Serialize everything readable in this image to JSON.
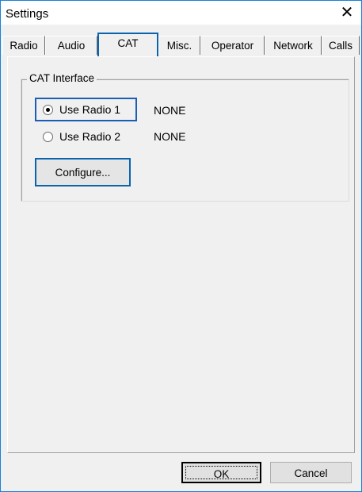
{
  "window": {
    "title": "Settings",
    "close_glyph": "✕"
  },
  "tabs": [
    {
      "label": "Radio"
    },
    {
      "label": "Audio"
    },
    {
      "label": "CAT"
    },
    {
      "label": "Misc."
    },
    {
      "label": "Operator"
    },
    {
      "label": "Network"
    },
    {
      "label": "Calls"
    }
  ],
  "active_tab": "CAT",
  "cat_interface": {
    "group_label": "CAT Interface",
    "radio1": {
      "label": "Use Radio 1",
      "value": "NONE",
      "checked": true
    },
    "radio2": {
      "label": "Use Radio 2",
      "value": "NONE",
      "checked": false
    },
    "configure_label": "Configure..."
  },
  "footer": {
    "ok_label": "OK",
    "cancel_label": "Cancel"
  },
  "colors": {
    "accent": "#0a64ad",
    "window_bg": "#f0f0f0"
  }
}
